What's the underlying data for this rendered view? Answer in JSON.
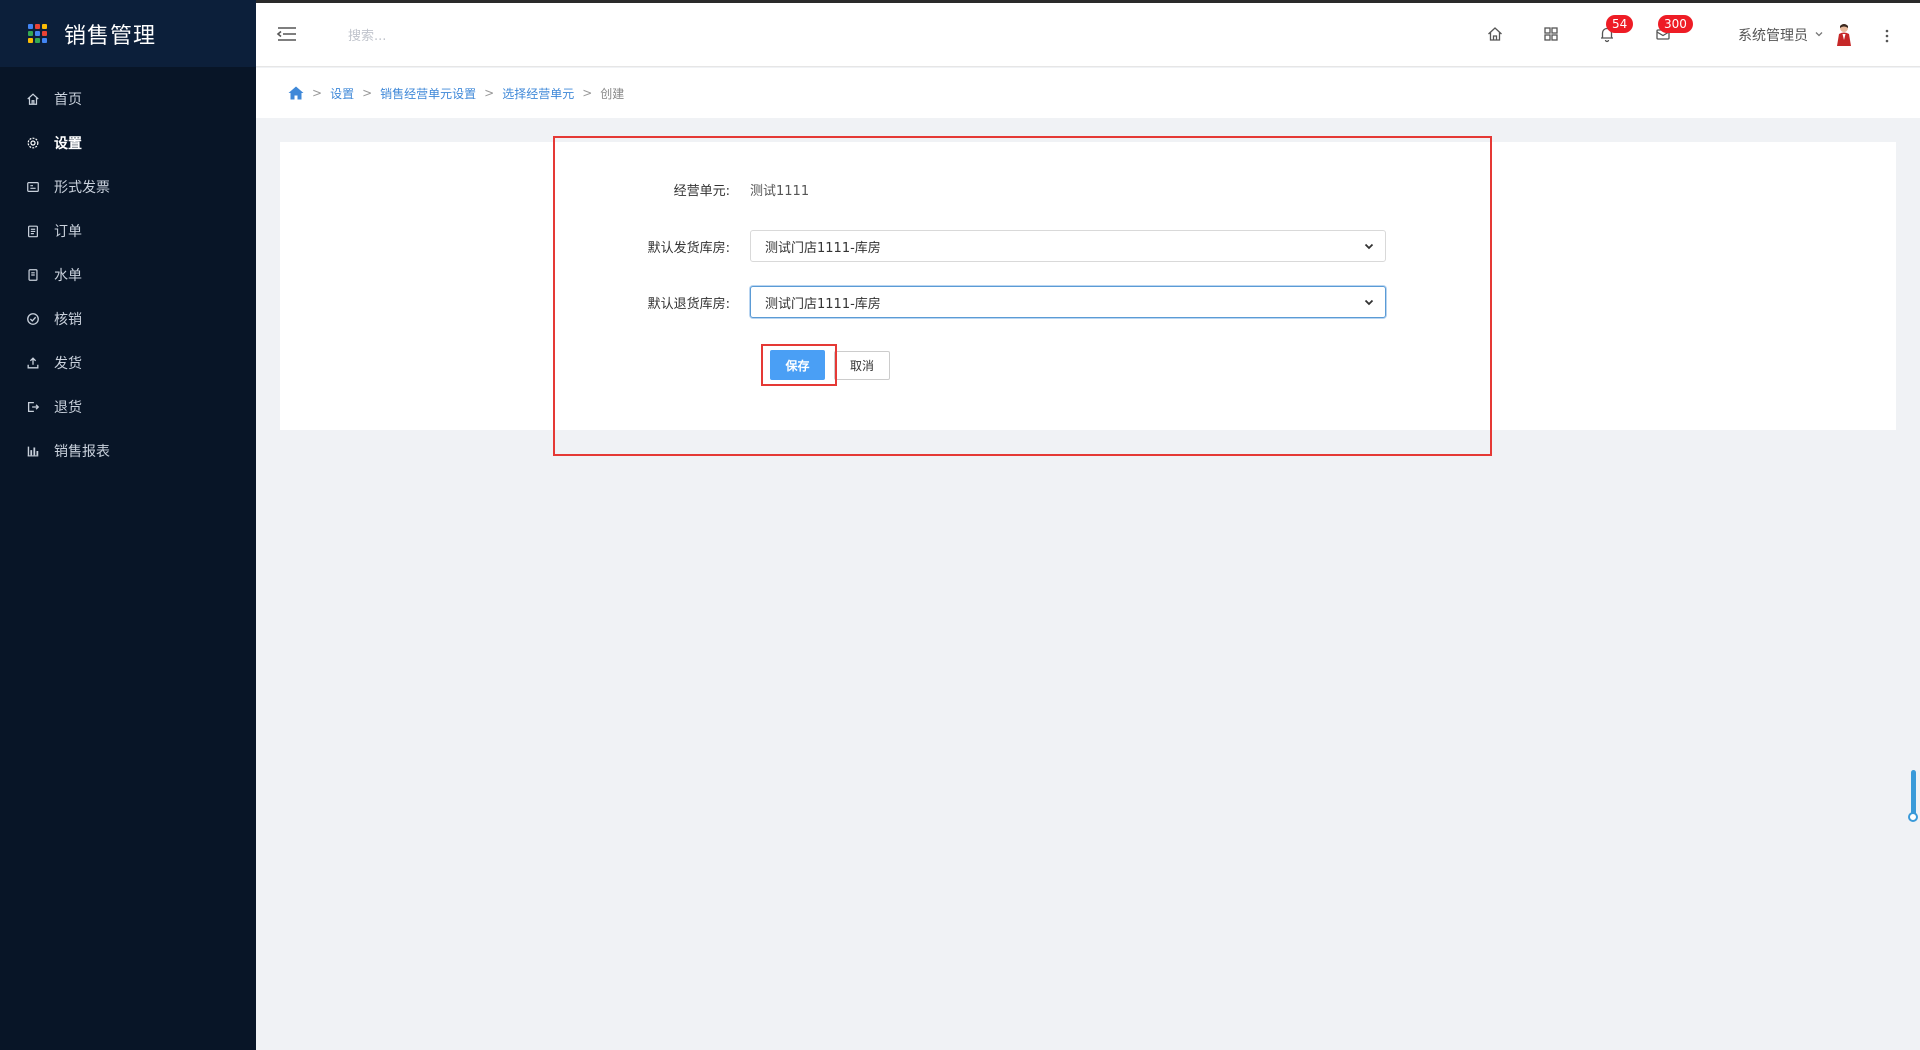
{
  "app": {
    "title": "销售管理",
    "logo_colors": [
      "#4285f4",
      "#ea4335",
      "#fbbc05",
      "#34a853",
      "#4285f4",
      "#ea4335",
      "#fbbc05",
      "#34a853",
      "#4285f4"
    ]
  },
  "sidebar": {
    "items": [
      {
        "label": "首页",
        "icon": "home-outline-icon"
      },
      {
        "label": "设置",
        "icon": "gear-icon",
        "active": true
      },
      {
        "label": "形式发票",
        "icon": "invoice-icon"
      },
      {
        "label": "订单",
        "icon": "clipboard-icon"
      },
      {
        "label": "水单",
        "icon": "receipt-icon"
      },
      {
        "label": "核销",
        "icon": "check-circle-icon"
      },
      {
        "label": "发货",
        "icon": "upload-icon"
      },
      {
        "label": "退货",
        "icon": "sign-out-icon"
      },
      {
        "label": "销售报表",
        "icon": "bar-chart-icon"
      }
    ]
  },
  "header": {
    "search_placeholder": "搜索...",
    "notifications_count": "54",
    "messages_count": "300",
    "user_name": "系统管理员"
  },
  "breadcrumb": {
    "items": [
      "设置",
      "销售经营单元设置",
      "选择经营单元"
    ],
    "current": "创建",
    "separator": ">"
  },
  "form": {
    "business_unit_label": "经营单元:",
    "business_unit_value": "测试1111",
    "default_ship_warehouse_label": "默认发货库房:",
    "default_ship_warehouse_value": "测试门店1111-库房",
    "default_return_warehouse_label": "默认退货库房:",
    "default_return_warehouse_value": "测试门店1111-库房",
    "save_label": "保存",
    "cancel_label": "取消"
  },
  "colors": {
    "sidebar_bg": "#081527",
    "accent": "#4a9ff5",
    "highlight": "#e53935",
    "badge": "#ee1c25"
  }
}
